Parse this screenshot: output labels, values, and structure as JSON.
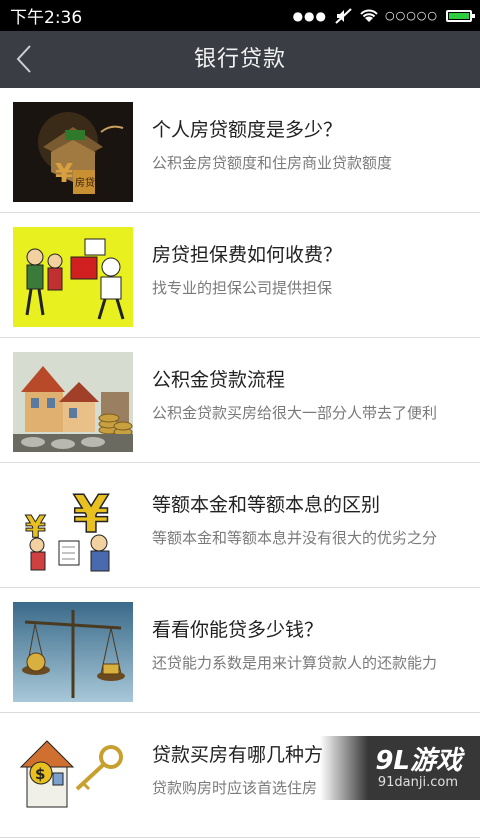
{
  "status_bar": {
    "time": "下午2:36",
    "signal": "○○○○○",
    "dots": "●●●"
  },
  "header": {
    "title": "银行贷款",
    "back_icon": "chevron-left-icon"
  },
  "items": [
    {
      "title": "个人房贷额度是多少？",
      "desc": "公积金房贷额度和住房商业贷款额度",
      "thumb": "house-money-illustration"
    },
    {
      "title": "房贷担保费如何收费？",
      "desc": "找专业的担保公司提供担保",
      "thumb": "cartoon-people-illustration"
    },
    {
      "title": "公积金贷款流程",
      "desc": "公积金贷款买房给很大一部分人带去了便利",
      "thumb": "houses-coins-illustration"
    },
    {
      "title": "等额本金和等额本息的区别",
      "desc": "等额本金和等额本息并没有很大的优劣之分",
      "thumb": "yen-people-illustration"
    },
    {
      "title": "看看你能贷多少钱？",
      "desc": "还贷能力系数是用来计算贷款人的还款能力",
      "thumb": "balance-scale-illustration"
    },
    {
      "title": "贷款买房有哪几种方",
      "desc": "贷款购房时应该首选住房",
      "thumb": "house-key-illustration"
    }
  ],
  "watermark": {
    "logo": "9L游戏",
    "url": "91danji.com"
  }
}
